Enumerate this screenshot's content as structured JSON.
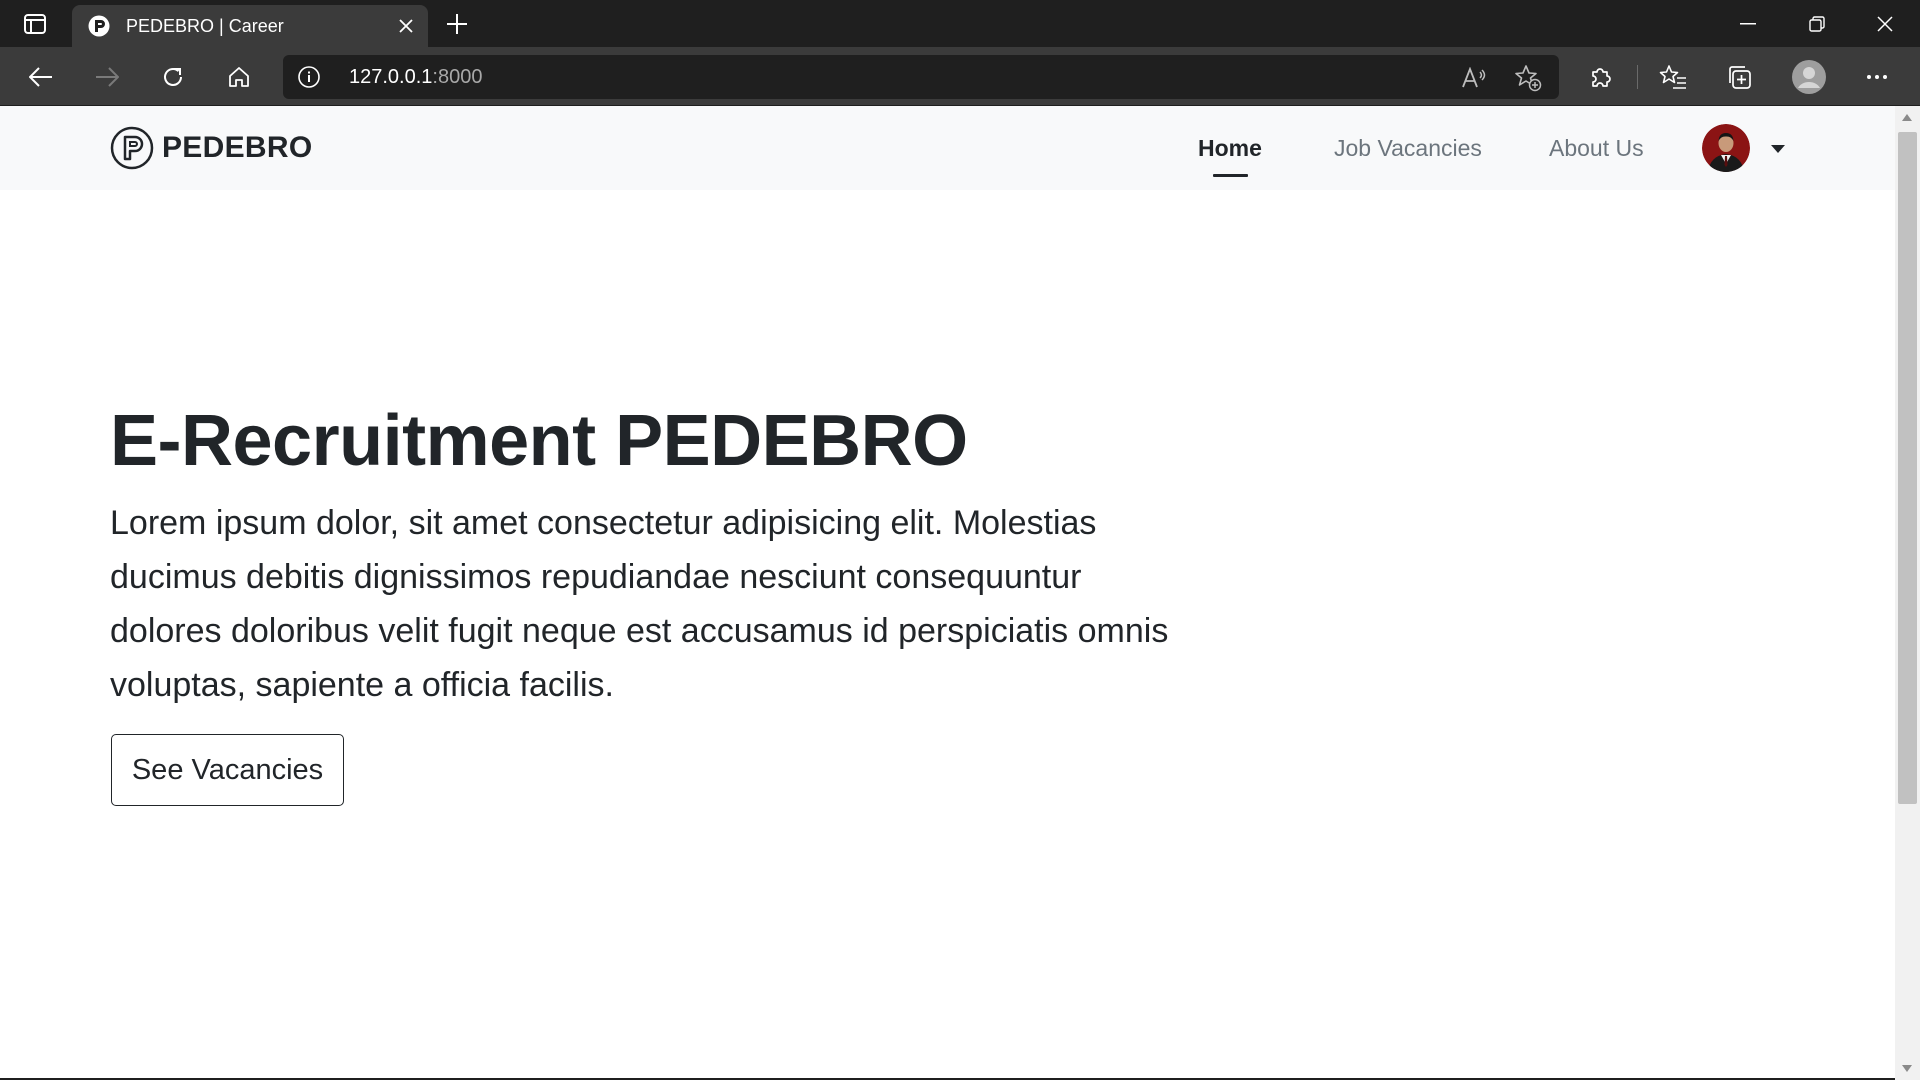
{
  "browser": {
    "tab": {
      "title": "PEDEBRO | Career"
    },
    "address": {
      "host": "127.0.0.1",
      "port": ":8000"
    }
  },
  "navbar": {
    "brand": "PEDEBRO",
    "links": [
      {
        "label": "Home",
        "active": true
      },
      {
        "label": "Job Vacancies",
        "active": false
      },
      {
        "label": "About Us",
        "active": false
      }
    ]
  },
  "hero": {
    "title": "E-Recruitment PEDEBRO",
    "text": "Lorem ipsum dolor, sit amet consectetur adipisicing elit. Molestias ducimus debitis dignissimos repudiandae nesciunt consequuntur dolores doloribus velit fugit neque est accusamus id perspiciatis omnis voluptas, sapiente a officia facilis.",
    "button": "See Vacancies"
  },
  "colors": {
    "chrome_dark": "#1f1f1f",
    "chrome_toolbar": "#3b3b3b",
    "navbar_bg": "#f8f9fa",
    "text_dark": "#212529",
    "text_muted": "#6c757d"
  }
}
